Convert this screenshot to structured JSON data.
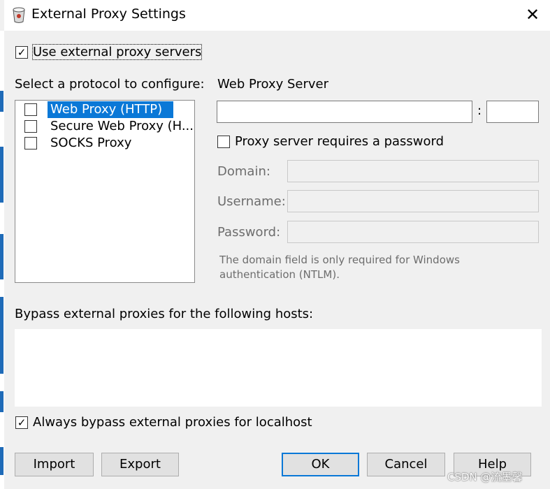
{
  "window": {
    "title": "External Proxy Settings",
    "close_glyph": "✕"
  },
  "use_external": {
    "label": "Use external proxy servers",
    "checked": true
  },
  "protocol": {
    "heading": "Select a protocol to configure:",
    "items": [
      {
        "label": "Web Proxy (HTTP)",
        "checked": false,
        "selected": true
      },
      {
        "label": "Secure Web Proxy (H...",
        "checked": false,
        "selected": false
      },
      {
        "label": "SOCKS Proxy",
        "checked": false,
        "selected": false
      }
    ]
  },
  "server": {
    "heading": "Web Proxy Server",
    "host_value": "",
    "separator": ":",
    "port_value": "",
    "requires_password": {
      "label": "Proxy server requires a password",
      "checked": false
    },
    "domain_label": "Domain:",
    "username_label": "Username:",
    "password_label": "Password:",
    "note": "The domain field is only required for Windows authentication (NTLM)."
  },
  "bypass": {
    "heading": "Bypass external proxies for the following hosts:",
    "value": "",
    "localhost": {
      "label": "Always bypass external proxies for localhost",
      "checked": true
    }
  },
  "buttons": {
    "import": "Import",
    "export": "Export",
    "ok": "OK",
    "cancel": "Cancel",
    "help": "Help"
  },
  "watermark": "CSDN @流墨馨",
  "colors": {
    "selection": "#0a78d7",
    "background": "#f0f0f0"
  },
  "icons": {
    "title": "proxy-app-icon",
    "check": "✓"
  }
}
